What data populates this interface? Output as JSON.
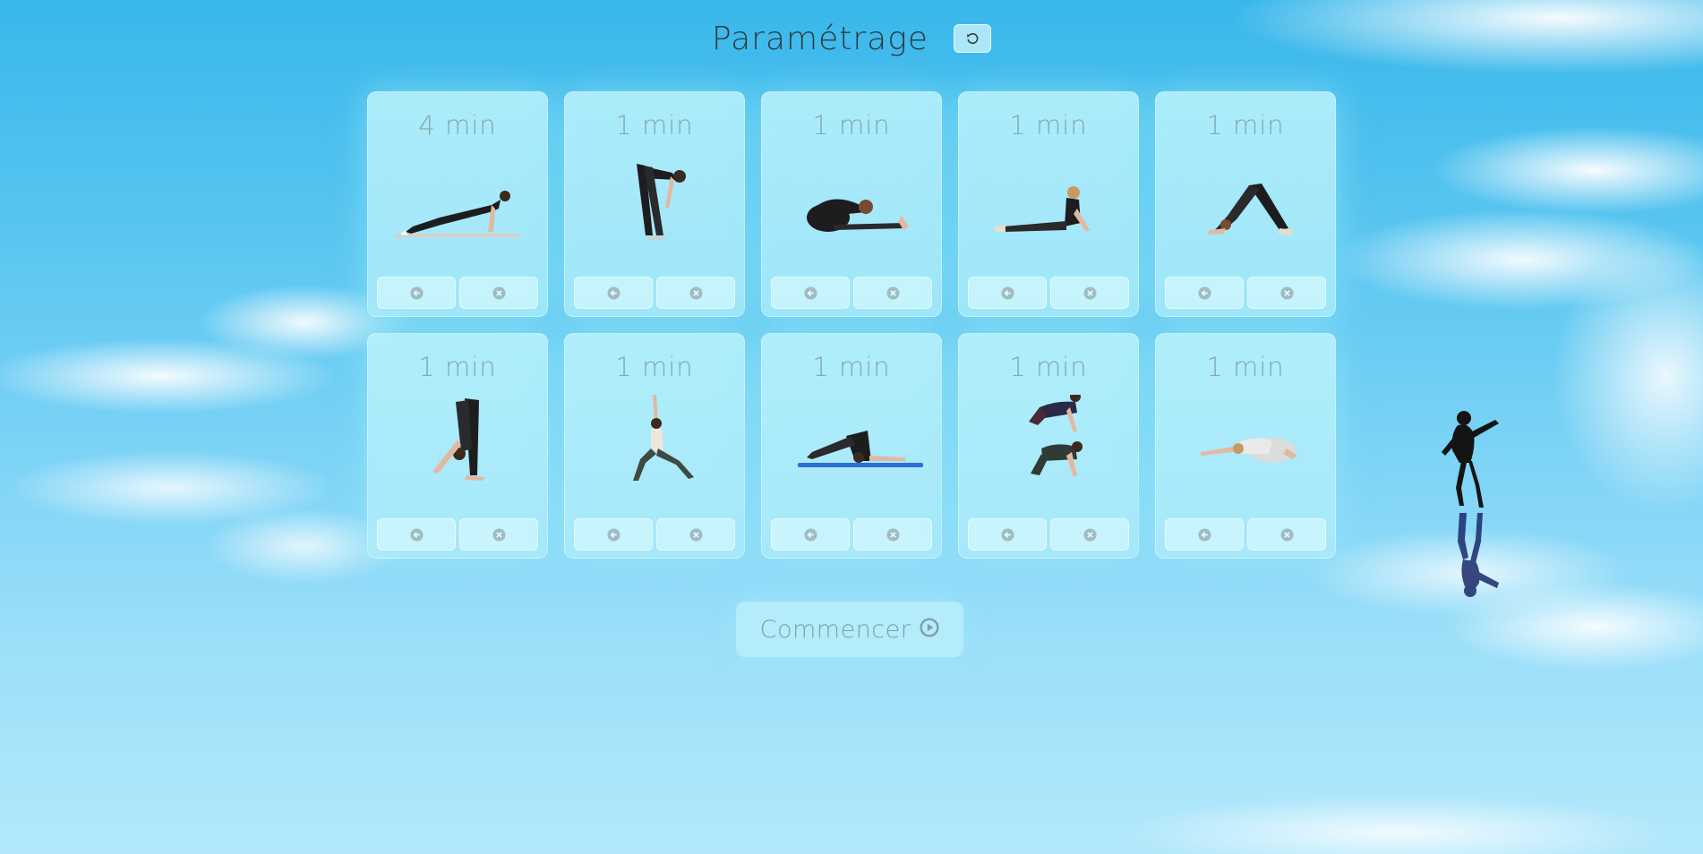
{
  "header": {
    "title": "Paramétrage",
    "reset_icon": "undo-icon"
  },
  "exercises": [
    {
      "duration": "4 min",
      "pose": "plank"
    },
    {
      "duration": "1 min",
      "pose": "standing-forward-bend"
    },
    {
      "duration": "1 min",
      "pose": "seated-forward-bend"
    },
    {
      "duration": "1 min",
      "pose": "cobra"
    },
    {
      "duration": "1 min",
      "pose": "downward-dog"
    },
    {
      "duration": "1 min",
      "pose": "wide-forward-fold"
    },
    {
      "duration": "1 min",
      "pose": "warrior-one"
    },
    {
      "duration": "1 min",
      "pose": "plow"
    },
    {
      "duration": "1 min",
      "pose": "cat-cow"
    },
    {
      "duration": "1 min",
      "pose": "child-pose"
    }
  ],
  "card_actions": {
    "move_icon": "arrow-left-circle-icon",
    "remove_icon": "close-circle-icon"
  },
  "start": {
    "label": "Commencer",
    "icon": "play-circle-icon"
  },
  "colors": {
    "title": "#2e3a3f",
    "duration": "#86a7ae",
    "card": "#bff2fc",
    "icon": "#9fbcc2"
  }
}
